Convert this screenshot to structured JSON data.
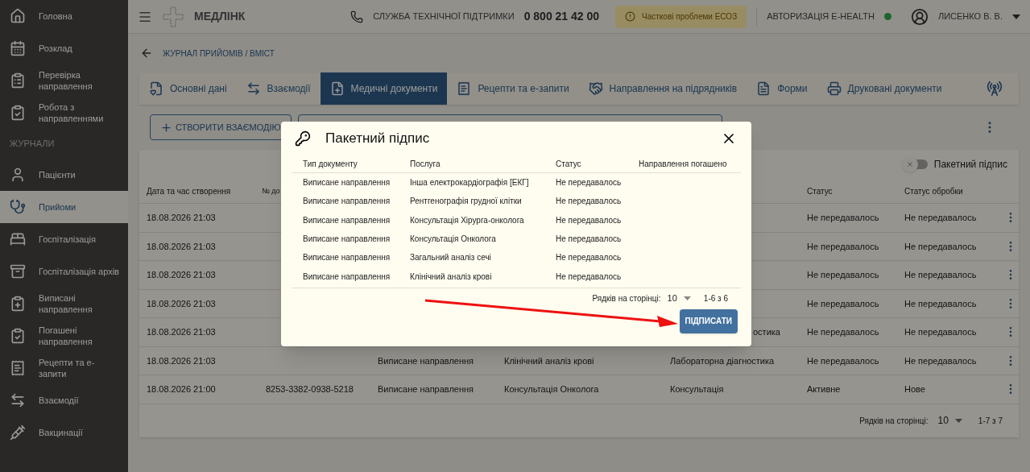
{
  "sidebar": {
    "items_top": [
      {
        "label": "Головна",
        "selected": false
      },
      {
        "label": "Розклад",
        "selected": false
      },
      {
        "label": "Перевірка направлення",
        "selected": false
      },
      {
        "label": "Робота з направленнями",
        "selected": false
      }
    ],
    "section_title": "ЖУРНАЛИ",
    "items": [
      {
        "label": "Пацієнти",
        "selected": false
      },
      {
        "label": "Прийоми",
        "selected": true
      },
      {
        "label": "Госпіталізація",
        "selected": false
      },
      {
        "label": "Госпіталізація архів",
        "selected": false
      },
      {
        "label": "Виписані направлення",
        "selected": false
      },
      {
        "label": "Погашені направлення",
        "selected": false
      },
      {
        "label": "Рецепти та е-запити",
        "selected": false
      },
      {
        "label": "Взаємодії",
        "selected": false
      },
      {
        "label": "Вакцинації",
        "selected": false
      }
    ]
  },
  "header": {
    "logo": "МЕДЛІНК",
    "support_label": "СЛУЖБА ТЕХНІЧНОЇ ПІДТРИМКИ",
    "support_phone": "0 800 21 42 00",
    "alert": "Часткові проблеми ЕСОЗ",
    "auth_label": "АВТОРИЗАЦІЯ E-HEALTH",
    "auth_online": true,
    "user": "ЛИСЕНКО В. В."
  },
  "breadcrumb": "ЖУРНАЛ ПРИЙОМІВ / ВМІСТ",
  "tabs": [
    {
      "label": "Основні дані",
      "selected": false
    },
    {
      "label": "Взаємодії",
      "selected": false
    },
    {
      "label": "Медичні документи",
      "selected": true
    },
    {
      "label": "Рецепти та е-запити",
      "selected": false
    },
    {
      "label": "Направлення на підрядників",
      "selected": false
    },
    {
      "label": "Форми",
      "selected": false
    },
    {
      "label": "Друковані документи",
      "selected": false
    }
  ],
  "create_button": "СТВОРИТИ ВЗАЄМОДІЮ",
  "table": {
    "batch_toggle": {
      "label": "Пакетний підпис",
      "on": false
    },
    "columns": [
      "Дата та час створення",
      "№ до",
      "Статус",
      "Статус обробки"
    ],
    "rows": [
      {
        "date": "18.08.2026 21:03",
        "status": "Не передавалось",
        "processing": "Не передавалось"
      },
      {
        "date": "18.08.2026 21:03",
        "status": "Не передавалось",
        "processing": "Не передавалось"
      },
      {
        "date": "18.08.2026 21:03",
        "status": "Не передавалось",
        "processing": "Не передавалось"
      },
      {
        "date": "18.08.2026 21:03",
        "status": "Не передавалось",
        "processing": "Не передавалось"
      },
      {
        "date": "18.08.2026 21:03",
        "category": "остика",
        "status": "Не передавалось",
        "processing": "Не передавалось"
      },
      {
        "date": "18.08.2026 21:03",
        "type": "Виписане направлення",
        "service": "Клінічний аналіз крові",
        "category": "Лабораторна діагностика",
        "status": "Не передавалось",
        "processing": "Не передавалось"
      },
      {
        "date": "18.08.2026 21:00",
        "number": "8253-3382-0938-5218",
        "type": "Виписане направлення",
        "service": "Консультація Онколога",
        "category": "Консультація",
        "status": "Активне",
        "processing": "Нове"
      }
    ],
    "pagination": {
      "label": "Рядків на сторінці:",
      "per_page": "10",
      "range": "1-7 з 7"
    }
  },
  "modal": {
    "title": "Пакетний підпис",
    "columns": [
      "Тип документу",
      "Послуга",
      "Статус",
      "Направлення погашено"
    ],
    "rows": [
      {
        "type": "Виписане направлення",
        "service": "Інша електрокардіографія [ЕКГ]",
        "status": "Не передавалось"
      },
      {
        "type": "Виписане направлення",
        "service": "Рентгенографія грудної клітки",
        "status": "Не передавалось"
      },
      {
        "type": "Виписане направлення",
        "service": "Консультація Хірурга-онколога",
        "status": "Не передавалось"
      },
      {
        "type": "Виписане направлення",
        "service": "Консультація Онколога",
        "status": "Не передавалось"
      },
      {
        "type": "Виписане направлення",
        "service": "Загальний аналіз сечі",
        "status": "Не передавалось"
      },
      {
        "type": "Виписане направлення",
        "service": "Клінічний аналіз крові",
        "status": "Не передавалось"
      }
    ],
    "pagination": {
      "label": "Рядків на сторінці:",
      "per_page": "10",
      "range": "1-6 з 6"
    },
    "sign_button": "ПІДПИСАТИ"
  }
}
